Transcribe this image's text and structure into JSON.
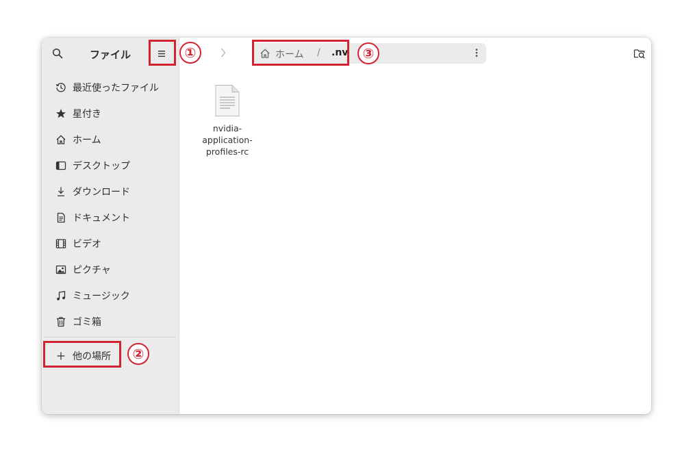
{
  "sidebar": {
    "title": "ファイル",
    "items": [
      {
        "label": "最近使ったファイル",
        "icon": "clock-icon"
      },
      {
        "label": "星付き",
        "icon": "star-icon"
      },
      {
        "label": "ホーム",
        "icon": "home-icon"
      },
      {
        "label": "デスクトップ",
        "icon": "desktop-icon"
      },
      {
        "label": "ダウンロード",
        "icon": "download-icon"
      },
      {
        "label": "ドキュメント",
        "icon": "document-icon"
      },
      {
        "label": "ビデオ",
        "icon": "video-icon"
      },
      {
        "label": "ピクチャ",
        "icon": "picture-icon"
      },
      {
        "label": "ミュージック",
        "icon": "music-icon"
      },
      {
        "label": "ゴミ箱",
        "icon": "trash-icon"
      }
    ],
    "other_locations": {
      "label": "他の場所",
      "icon": "plus-icon"
    }
  },
  "pathbar": {
    "home_label": "ホーム",
    "separator": "/",
    "current": ".nv"
  },
  "files": [
    {
      "name": "nvidia-application-profiles-rc",
      "icon": "text-file-icon"
    }
  ],
  "annotations": [
    {
      "number": "①"
    },
    {
      "number": "②"
    },
    {
      "number": "③"
    }
  ],
  "colors": {
    "highlight": "#d32330",
    "sidebar_bg": "#ebebeb",
    "pathbar_bg": "#ebebeb"
  }
}
